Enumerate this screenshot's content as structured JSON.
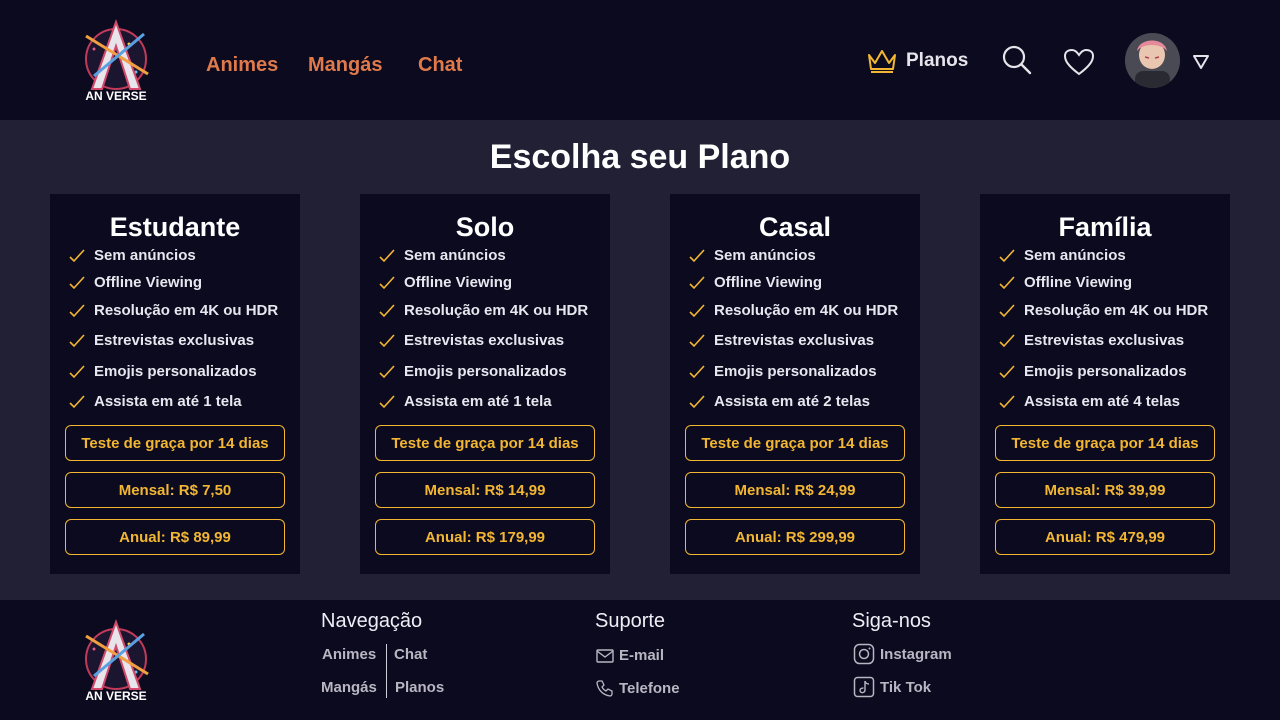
{
  "brand": {
    "logo_text": "AN VERSE"
  },
  "nav": {
    "animes": "Animes",
    "mangas": "Mangás",
    "chat": "Chat"
  },
  "header": {
    "plans_label": "Planos"
  },
  "icons": {
    "crown": "crown-icon",
    "search": "search-icon",
    "favorites": "heart-icon",
    "menu": "triangle-down-icon",
    "check": "check-icon",
    "email": "mail-icon",
    "phone": "phone-icon",
    "instagram": "instagram-icon",
    "tiktok": "tiktok-icon"
  },
  "colors": {
    "accent_gold": "#f2b632",
    "nav_orange": "#e07a4b",
    "header_bg": "#0b0a1f",
    "page_bg": "#222035"
  },
  "page": {
    "title": "Escolha seu Plano"
  },
  "plans": [
    {
      "name": "Estudante",
      "features": [
        "Sem anúncios",
        "Offline Viewing",
        "Resolução em 4K ou HDR",
        "Estrevistas exclusivas",
        "Emojis personalizados",
        "Assista em até 1 tela"
      ],
      "trial": "Teste de graça por 14 dias",
      "monthly": "Mensal: R$ 7,50",
      "yearly": "Anual: R$ 89,99"
    },
    {
      "name": "Solo",
      "features": [
        "Sem anúncios",
        "Offline Viewing",
        "Resolução em 4K ou HDR",
        "Estrevistas exclusivas",
        "Emojis personalizados",
        "Assista em até 1 tela"
      ],
      "trial": "Teste de graça por 14 dias",
      "monthly": "Mensal: R$ 14,99",
      "yearly": "Anual: R$ 179,99"
    },
    {
      "name": "Casal",
      "features": [
        "Sem anúncios",
        "Offline Viewing",
        "Resolução em 4K ou HDR",
        "Estrevistas exclusivas",
        "Emojis personalizados",
        "Assista em até 2 telas"
      ],
      "trial": "Teste de graça por 14 dias",
      "monthly": "Mensal: R$ 24,99",
      "yearly": "Anual: R$ 299,99"
    },
    {
      "name": "Família",
      "features": [
        "Sem anúncios",
        "Offline Viewing",
        "Resolução em 4K ou HDR",
        "Estrevistas exclusivas",
        "Emojis personalizados",
        "Assista em até 4 telas"
      ],
      "trial": "Teste de graça por 14 dias",
      "monthly": "Mensal: R$ 39,99",
      "yearly": "Anual: R$ 479,99"
    }
  ],
  "footer": {
    "nav_heading": "Navegação",
    "nav_links": {
      "animes": "Animes",
      "chat": "Chat",
      "mangas": "Mangás",
      "planos": "Planos"
    },
    "support_heading": "Suporte",
    "support_links": {
      "email": "E-mail",
      "phone": "Telefone"
    },
    "social_heading": "Siga-nos",
    "social_links": {
      "instagram": "Instagram",
      "tiktok": "Tik Tok"
    }
  }
}
